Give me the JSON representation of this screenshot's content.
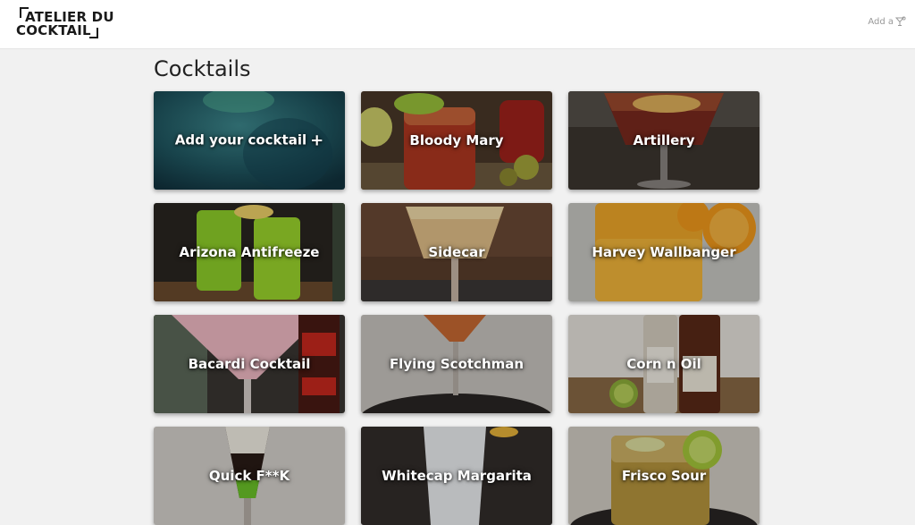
{
  "header": {
    "logo_line1": "ATELIER DU",
    "logo_line2": "COCKTAIL",
    "add_link_label": "Add a"
  },
  "main": {
    "title": "Cocktails",
    "add_card_label": "Add your cocktail",
    "cocktails": [
      {
        "name": "Bloody Mary"
      },
      {
        "name": "Artillery"
      },
      {
        "name": "Arizona Antifreeze"
      },
      {
        "name": "Sidecar"
      },
      {
        "name": "Harvey Wallbanger"
      },
      {
        "name": "Bacardi Cocktail"
      },
      {
        "name": "Flying Scotchman"
      },
      {
        "name": "Corn n Oil"
      },
      {
        "name": "Quick F**K"
      },
      {
        "name": "Whitecap Margarita"
      },
      {
        "name": "Frisco Sour"
      }
    ]
  },
  "icons": {
    "add_card": "plus-icon",
    "header_add": "cocktail-glass-icon"
  },
  "colors": {
    "page_background": "#f1f1f1",
    "header_background": "#ffffff",
    "card_text": "#ffffff"
  }
}
